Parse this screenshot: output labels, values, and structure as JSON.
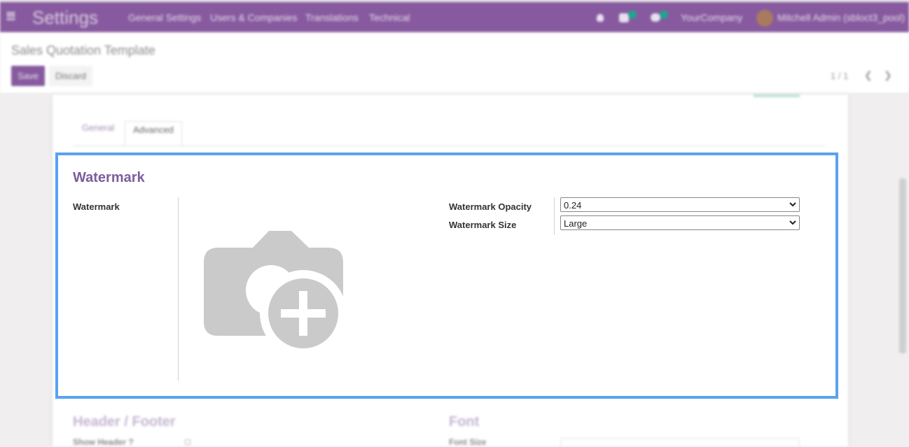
{
  "navbar": {
    "app_name": "Settings",
    "menu": [
      "General Settings",
      "Users & Companies",
      "Translations",
      "Technical"
    ],
    "company": "YourCompany",
    "user": "Mitchell Admin (sbloct3_pool)"
  },
  "control_panel": {
    "breadcrumb": "Sales Quotation Template",
    "save_label": "Save",
    "discard_label": "Discard",
    "pager": "1 / 1"
  },
  "tabs": [
    {
      "label": "General"
    },
    {
      "label": "Advanced"
    }
  ],
  "watermark": {
    "title": "Watermark",
    "image_label": "Watermark",
    "opacity_label": "Watermark Opacity",
    "opacity_value": "0.24",
    "size_label": "Watermark Size",
    "size_value": "Large"
  },
  "lower_sections": {
    "header_footer_title": "Header / Footer",
    "show_header_label": "Show Header ?",
    "font_title": "Font",
    "font_size_label": "Font Size"
  },
  "colors": {
    "brand": "#875a9f",
    "highlight": "#58a3ef",
    "section_title": "#7c5e9b"
  }
}
